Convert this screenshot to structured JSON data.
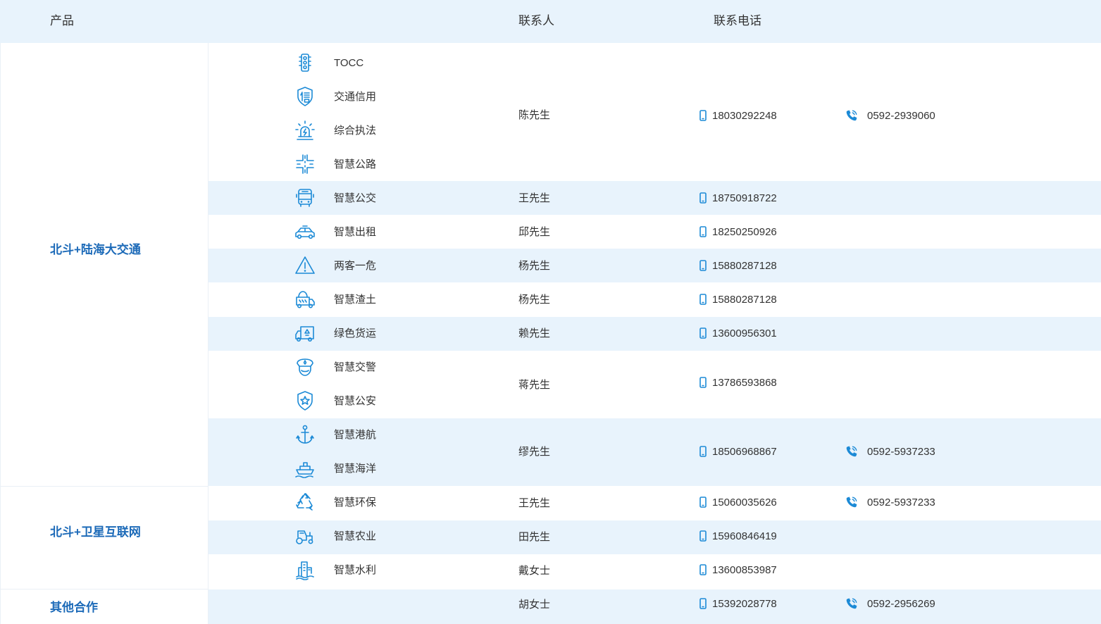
{
  "header": {
    "product": "产品",
    "contact": "联系人",
    "phone": "联系电话"
  },
  "categories": [
    {
      "name": "北斗+陆海大交通"
    },
    {
      "name": "北斗+卫星互联网"
    },
    {
      "name": "其他合作"
    }
  ],
  "products": [
    {
      "name": "TOCC",
      "icon": "traffic-light-icon"
    },
    {
      "name": "交通信用",
      "icon": "credit-badge-icon"
    },
    {
      "name": "综合执法",
      "icon": "alarm-light-icon"
    },
    {
      "name": "智慧公路",
      "icon": "road-crossing-icon"
    },
    {
      "name": "智慧公交",
      "icon": "bus-icon"
    },
    {
      "name": "智慧出租",
      "icon": "taxi-icon"
    },
    {
      "name": "两客一危",
      "icon": "warning-triangle-icon"
    },
    {
      "name": "智慧渣土",
      "icon": "muck-truck-icon"
    },
    {
      "name": "绿色货运",
      "icon": "freight-truck-icon"
    },
    {
      "name": "智慧交警",
      "icon": "police-cap-icon"
    },
    {
      "name": "智慧公安",
      "icon": "police-shield-icon"
    },
    {
      "name": "智慧港航",
      "icon": "anchor-icon"
    },
    {
      "name": "智慧海洋",
      "icon": "ship-icon"
    },
    {
      "name": "智慧环保",
      "icon": "recycle-icon"
    },
    {
      "name": "智慧农业",
      "icon": "tractor-icon"
    },
    {
      "name": "智慧水利",
      "icon": "water-building-icon"
    }
  ],
  "contacts": [
    {
      "person": "陈先生",
      "mobile": "18030292248",
      "tel": "0592-2939060"
    },
    {
      "person": "王先生",
      "mobile": "18750918722"
    },
    {
      "person": "邱先生",
      "mobile": "18250250926"
    },
    {
      "person": "杨先生",
      "mobile": "15880287128"
    },
    {
      "person": "杨先生",
      "mobile": "15880287128"
    },
    {
      "person": "赖先生",
      "mobile": "13600956301"
    },
    {
      "person": "蒋先生",
      "mobile": "13786593868"
    },
    {
      "person": "缪先生",
      "mobile": "18506968867",
      "tel": "0592-5937233"
    },
    {
      "person": "王先生",
      "mobile": "15060035626",
      "tel": "0592-5937233"
    },
    {
      "person": "田先生",
      "mobile": "15960846419"
    },
    {
      "person": "戴女士",
      "mobile": "13600853987"
    },
    {
      "person": "胡女士",
      "mobile": "15392028778",
      "tel": "0592-2956269"
    }
  ],
  "colors": {
    "header_bg": "#e8f3fc",
    "band_bg": "#e8f3fc",
    "category_text": "#1c6ab8",
    "icon": "#1c8ad6",
    "text": "#333333"
  },
  "icons": {
    "mobile": "mobile-phone-icon",
    "telephone": "telephone-icon"
  }
}
